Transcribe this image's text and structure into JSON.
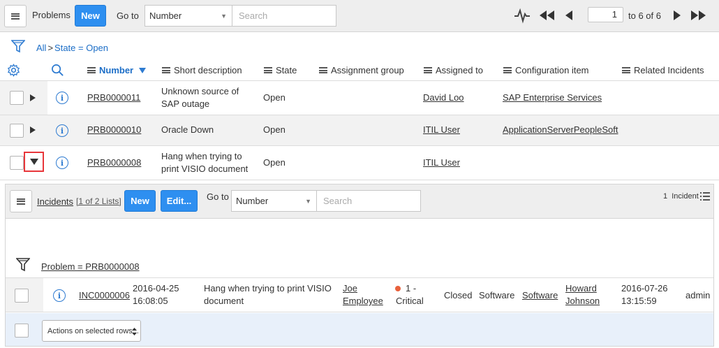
{
  "header": {
    "title": "Problems",
    "new_label": "New",
    "goto_label": "Go to",
    "goto_field": "Number",
    "search_placeholder": "Search",
    "page_current": "1",
    "page_range": "to 6 of 6"
  },
  "breadcrumb": {
    "all": "All",
    "sep": ">",
    "filter": "State = Open"
  },
  "columns": [
    "Number",
    "Short description",
    "State",
    "Assignment group",
    "Assigned to",
    "Configuration item",
    "Related Incidents"
  ],
  "rows": [
    {
      "number": "PRB0000011",
      "desc": "Unknown source of SAP outage",
      "state": "Open",
      "group": "",
      "assigned": "David Loo",
      "ci": "SAP Enterprise Services",
      "related": ""
    },
    {
      "number": "PRB0000010",
      "desc": "Oracle Down",
      "state": "Open",
      "group": "",
      "assigned": "ITIL User",
      "ci": "ApplicationServerPeopleSoft",
      "related": ""
    },
    {
      "number": "PRB0000008",
      "desc": "Hang when trying to print VISIO document",
      "state": "Open",
      "group": "",
      "assigned": "ITIL User",
      "ci": "",
      "related": ""
    }
  ],
  "related": {
    "title": "Incidents",
    "count": "[1 of 2 Lists]",
    "new_label": "New",
    "edit_label": "Edit...",
    "goto_label": "Go to",
    "goto_field": "Number",
    "search_placeholder": "Search",
    "incident_count": "1  Incident",
    "filter": "Problem = PRB0000008",
    "row": {
      "number": "INC0000006",
      "opened": "2016-04-25 16:08:05",
      "desc": "Hang when trying to print VISIO document",
      "caller": "Joe Employee",
      "priority": "1 - Critical",
      "priority_color": "#e8613c",
      "state": "Closed",
      "category": "Software",
      "group": "Software",
      "assigned": "Howard Johnson",
      "updated": "2016-07-26 13:15:59",
      "updated_by": "admin"
    },
    "actions_label": "Actions on selected rows..."
  },
  "colors": {
    "accent": "#2e8ff0",
    "link": "#1c6ec7",
    "toolbar": "#eeeeee",
    "highlight": "#e8363a"
  }
}
